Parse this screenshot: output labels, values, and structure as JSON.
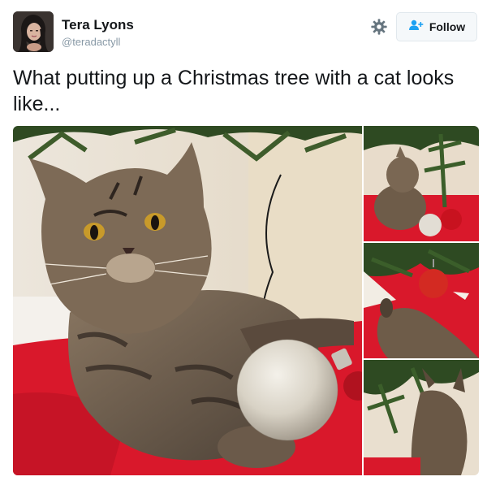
{
  "user": {
    "name": "Tera Lyons",
    "handle": "@teradactyll"
  },
  "actions": {
    "follow_label": "Follow"
  },
  "tweet": {
    "text": "What putting up a Christmas tree with a cat looks like..."
  },
  "colors": {
    "text": "#14171a",
    "muted": "#8899a6",
    "follow_icon": "#1da1f2",
    "tree_skirt": "#d9182b"
  },
  "icons": {
    "settings": "gear-icon",
    "follow": "add-user-icon"
  }
}
